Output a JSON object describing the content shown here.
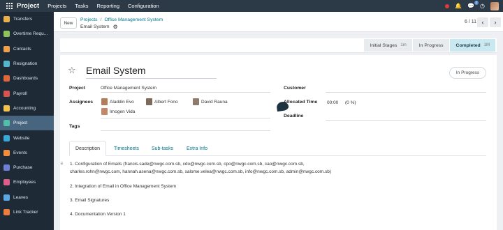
{
  "topbar": {
    "app_name": "Project",
    "menu": [
      "Projects",
      "Tasks",
      "Reporting",
      "Configuration"
    ],
    "chat_badge": "2",
    "icons": [
      "apps-grid-icon",
      "bell-icon",
      "chat-icon",
      "clock-icon",
      "avatar"
    ]
  },
  "sidebar": {
    "items": [
      {
        "label": "Transfers",
        "color": "#e8b04a"
      },
      {
        "label": "Overtime Requ...",
        "color": "#8cc35a"
      },
      {
        "label": "Contacts",
        "color": "#f0a04b"
      },
      {
        "label": "Resignation",
        "color": "#54b7c9"
      },
      {
        "label": "Dashboards",
        "color": "#e2663c"
      },
      {
        "label": "Payroll",
        "color": "#d9534f"
      },
      {
        "label": "Accounting",
        "color": "#f3c24b"
      },
      {
        "label": "Project",
        "color": "#4fc1a6",
        "active": true
      },
      {
        "label": "Website",
        "color": "#3aa7d9"
      },
      {
        "label": "Events",
        "color": "#f08c3a"
      },
      {
        "label": "Purchase",
        "color": "#6f7fd8"
      },
      {
        "label": "Employees",
        "color": "#e05d8a"
      },
      {
        "label": "Leaves",
        "color": "#5aa9e6"
      },
      {
        "label": "Link Tracker",
        "color": "#ef7b3c"
      }
    ]
  },
  "controlbar": {
    "new_label": "New",
    "breadcrumb_1": "Projects",
    "breadcrumb_sep": "/",
    "breadcrumb_2": "Office Management System",
    "current": "Email System",
    "pager": "6 / 11"
  },
  "stages": [
    {
      "label": "Initial Stages",
      "count": "1m"
    },
    {
      "label": "In Progress",
      "count": ""
    },
    {
      "label": "Completed",
      "count": "1M",
      "current": true
    }
  ],
  "form": {
    "title": "Email System",
    "status": "In Progress",
    "project_label": "Project",
    "project_value": "Office Management System",
    "assignees_label": "Assignees",
    "assignees": [
      {
        "name": "Aladdin Evo",
        "color": "#b27d5a"
      },
      {
        "name": "Albert Fono",
        "color": "#7d6a5a"
      },
      {
        "name": "David Rauna",
        "color": "#8f7b6c"
      },
      {
        "name": "Imogen Vida",
        "color": "#c08a6a"
      }
    ],
    "tags_label": "Tags",
    "customer_label": "Customer",
    "allocated_label": "Allocated Time",
    "allocated_value": "00:00",
    "allocated_pct": "(0 %)",
    "deadline_label": "Deadline"
  },
  "tabs": [
    "Description",
    "Timesheets",
    "Sub-tasks",
    "Extra Info"
  ],
  "description": {
    "handle": "⠿",
    "line1": "1. Configuration of Emails (francis.sade@nwgc.com.sb, cdo@nwgc.com.sb, cpo@nwgc.com.sb, cao@nwgc.com.sb,",
    "line1b": "charles.rohn@nwgc.com, hannah.asena@nwgc.com.sb, salome.velea@nwgc.com.sb, info@nwgc.com.sb, admin@nwgc.com.sb)",
    "line2": "2. Integration of Email in Office Management System",
    "line3": "3. Email Signatures",
    "line4": "4. Documentation Version 1"
  }
}
